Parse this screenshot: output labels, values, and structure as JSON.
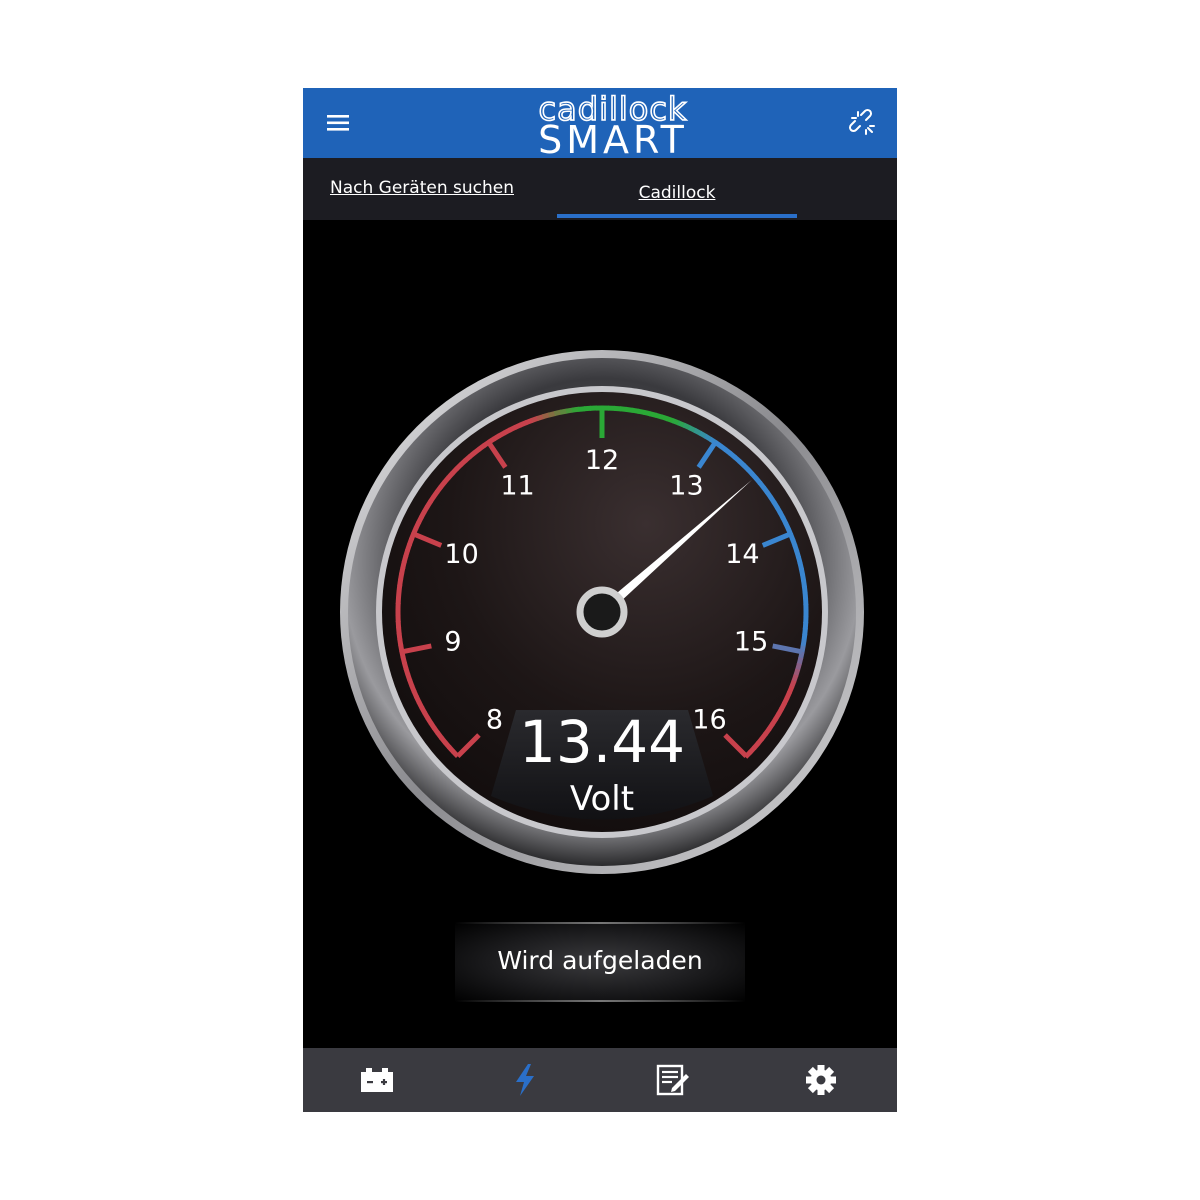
{
  "header": {
    "logo_line1": "cadillock",
    "logo_line2": "SMART",
    "menu_icon": "hamburger-menu-icon",
    "link_icon": "broken-link-icon"
  },
  "tabs": [
    {
      "label": "Nach Geräten suchen",
      "active": false
    },
    {
      "label": "Cadillock",
      "active": true
    }
  ],
  "gauge": {
    "value": "13.44",
    "value_number": 13.44,
    "unit": "Volt",
    "min": 8,
    "max": 16,
    "ticks": [
      "8",
      "9",
      "10",
      "11",
      "12",
      "13",
      "14",
      "15",
      "16"
    ]
  },
  "status": "Wird aufgeladen",
  "bottom_nav": [
    {
      "icon": "battery-icon",
      "active": false
    },
    {
      "icon": "lightning-icon",
      "active": true
    },
    {
      "icon": "notes-icon",
      "active": false
    },
    {
      "icon": "gear-icon",
      "active": false
    }
  ],
  "colors": {
    "header": "#1f63b8",
    "accent": "#2a6fc9",
    "zone_red": "#c8414c",
    "zone_green": "#2aa836",
    "zone_blue": "#3a86d0"
  }
}
